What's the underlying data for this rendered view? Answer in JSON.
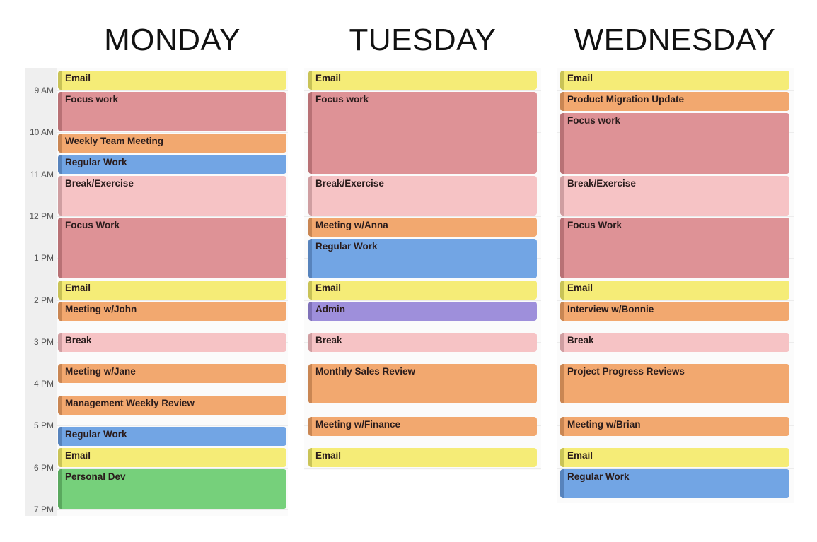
{
  "colors": {
    "email": {
      "fill": "#f5ec77",
      "bar": "#c9c357"
    },
    "focus": {
      "fill": "#de9296",
      "bar": "#b87175"
    },
    "meeting": {
      "fill": "#f2a86f",
      "bar": "#c98653"
    },
    "regular": {
      "fill": "#72a5e4",
      "bar": "#5783bc"
    },
    "break": {
      "fill": "#f6c3c5",
      "bar": "#cf9ea1"
    },
    "personal": {
      "fill": "#76d07b",
      "bar": "#5aa85e"
    },
    "admin": {
      "fill": "#9e8fdb",
      "bar": "#7f71b8"
    }
  },
  "hours": [
    "9 AM",
    "10 AM",
    "11 AM",
    "12 PM",
    "1 PM",
    "2 PM",
    "3 PM",
    "4 PM",
    "5 PM",
    "6 PM",
    "7 PM"
  ],
  "days": [
    {
      "name": "MONDAY",
      "events": [
        {
          "title": "Email",
          "type": "email",
          "start": 8.5,
          "end": 9.0
        },
        {
          "title": "Focus work",
          "type": "focus",
          "start": 9.0,
          "end": 10.0
        },
        {
          "title": "Weekly Team Meeting",
          "type": "meeting",
          "start": 10.0,
          "end": 10.5
        },
        {
          "title": "Regular Work",
          "type": "regular",
          "start": 10.5,
          "end": 11.0
        },
        {
          "title": "Break/Exercise",
          "type": "break",
          "start": 11.0,
          "end": 12.0
        },
        {
          "title": "Focus Work",
          "type": "focus",
          "start": 12.0,
          "end": 13.5
        },
        {
          "title": "Email",
          "type": "email",
          "start": 13.5,
          "end": 14.0
        },
        {
          "title": "Meeting w/John",
          "type": "meeting",
          "start": 14.0,
          "end": 14.5
        },
        {
          "title": "Break",
          "type": "break",
          "start": 14.75,
          "end": 15.25
        },
        {
          "title": "Meeting w/Jane",
          "type": "meeting",
          "start": 15.5,
          "end": 16.0
        },
        {
          "title": "Management Weekly Review",
          "type": "meeting",
          "start": 16.25,
          "end": 16.75
        },
        {
          "title": "Regular Work",
          "type": "regular",
          "start": 17.0,
          "end": 17.5
        },
        {
          "title": "Email",
          "type": "email",
          "start": 17.5,
          "end": 18.0
        },
        {
          "title": "Personal Dev",
          "type": "personal",
          "start": 18.0,
          "end": 19.0
        }
      ]
    },
    {
      "name": "TUESDAY",
      "events": [
        {
          "title": "Email",
          "type": "email",
          "start": 8.5,
          "end": 9.0
        },
        {
          "title": "Focus work",
          "type": "focus",
          "start": 9.0,
          "end": 11.0
        },
        {
          "title": "Break/Exercise",
          "type": "break",
          "start": 11.0,
          "end": 12.0
        },
        {
          "title": "Meeting w/Anna",
          "type": "meeting",
          "start": 12.0,
          "end": 12.5
        },
        {
          "title": "Regular Work",
          "type": "regular",
          "start": 12.5,
          "end": 13.5
        },
        {
          "title": "Email",
          "type": "email",
          "start": 13.5,
          "end": 14.0
        },
        {
          "title": "Admin",
          "type": "admin",
          "start": 14.0,
          "end": 14.5
        },
        {
          "title": "Break",
          "type": "break",
          "start": 14.75,
          "end": 15.25
        },
        {
          "title": "Monthly Sales Review",
          "type": "meeting",
          "start": 15.5,
          "end": 16.5
        },
        {
          "title": "Meeting w/Finance",
          "type": "meeting",
          "start": 16.75,
          "end": 17.25
        },
        {
          "title": "Email",
          "type": "email",
          "start": 17.5,
          "end": 18.0
        }
      ]
    },
    {
      "name": "WEDNESDAY",
      "events": [
        {
          "title": "Email",
          "type": "email",
          "start": 8.5,
          "end": 9.0
        },
        {
          "title": "Product Migration Update",
          "type": "meeting",
          "start": 9.0,
          "end": 9.5
        },
        {
          "title": "Focus work",
          "type": "focus",
          "start": 9.5,
          "end": 11.0
        },
        {
          "title": "Break/Exercise",
          "type": "break",
          "start": 11.0,
          "end": 12.0
        },
        {
          "title": "Focus Work",
          "type": "focus",
          "start": 12.0,
          "end": 13.5
        },
        {
          "title": "Email",
          "type": "email",
          "start": 13.5,
          "end": 14.0
        },
        {
          "title": "Interview w/Bonnie",
          "type": "meeting",
          "start": 14.0,
          "end": 14.5
        },
        {
          "title": "Break",
          "type": "break",
          "start": 14.75,
          "end": 15.25
        },
        {
          "title": "Project Progress Reviews",
          "type": "meeting",
          "start": 15.5,
          "end": 16.5
        },
        {
          "title": "Meeting w/Brian",
          "type": "meeting",
          "start": 16.75,
          "end": 17.25
        },
        {
          "title": "Email",
          "type": "email",
          "start": 17.5,
          "end": 18.0
        },
        {
          "title": "Regular Work",
          "type": "regular",
          "start": 18.0,
          "end": 18.75
        }
      ]
    }
  ]
}
